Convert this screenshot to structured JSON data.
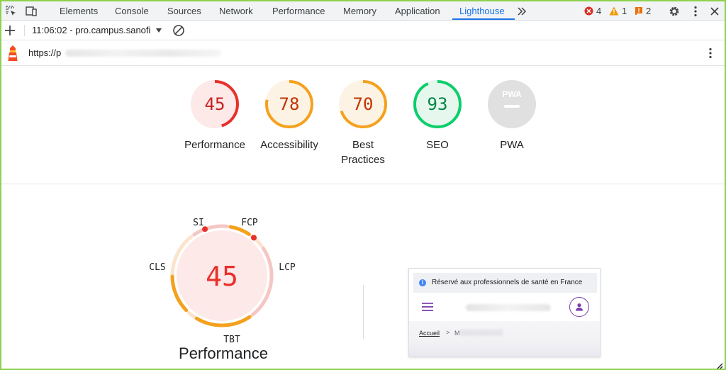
{
  "toolbar": {
    "tabs": [
      {
        "label": "Elements"
      },
      {
        "label": "Console"
      },
      {
        "label": "Sources"
      },
      {
        "label": "Network"
      },
      {
        "label": "Performance"
      },
      {
        "label": "Memory"
      },
      {
        "label": "Application"
      },
      {
        "label": "Lighthouse"
      }
    ],
    "active_tab": "Lighthouse",
    "more_tabs_icon": "double-chevron-right-icon",
    "errors_count": "4",
    "warnings_count": "1",
    "issues_count": "2",
    "colors": {
      "accent": "#1a73e8",
      "error": "#d93025",
      "warning": "#f29900",
      "issue": "#e8710a"
    }
  },
  "report_bar": {
    "selected_report": "11:06:02 - pro.campus.sanofi"
  },
  "url_bar": {
    "url": "https://p"
  },
  "categories": [
    {
      "label": "Performance",
      "score": "45",
      "value": 45,
      "color": "#e8302b",
      "bg": "#fce9e8"
    },
    {
      "label": "Accessibility",
      "score": "78",
      "value": 78,
      "color": "#f4a11d",
      "bg": "#fdf3e4"
    },
    {
      "label": "Best Practices",
      "score": "70",
      "value": 70,
      "color": "#f4a11d",
      "bg": "#fdf3e4"
    },
    {
      "label": "SEO",
      "score": "93",
      "value": 93,
      "color": "#0cce6b",
      "bg": "#e6f8ee"
    },
    {
      "label": "PWA",
      "score": "PWA",
      "value": null,
      "color": "#bdbdbd",
      "bg": "#e0e0e0"
    }
  ],
  "performance_detail": {
    "score": "45",
    "title": "Performance",
    "metrics": [
      {
        "label": "SI"
      },
      {
        "label": "FCP"
      },
      {
        "label": "LCP"
      },
      {
        "label": "TBT"
      },
      {
        "label": "CLS"
      }
    ]
  },
  "screenshot": {
    "banner_text": "Réservé aux professionnels de santé en France",
    "breadcrumb_home": "Accueil",
    "breadcrumb_sep": ">",
    "breadcrumb_current": "M"
  }
}
